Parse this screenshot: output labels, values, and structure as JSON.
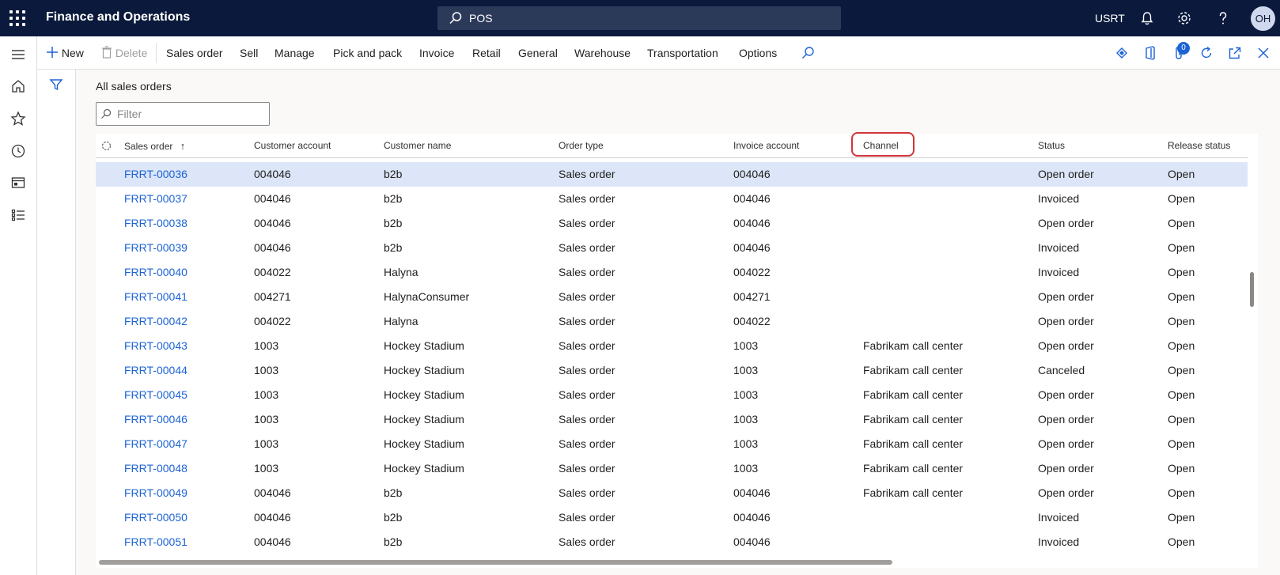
{
  "header": {
    "app_title": "Finance and Operations",
    "search_value": "POS",
    "user_code": "USRT",
    "avatar_initials": "OH"
  },
  "actions": {
    "new_label": "New",
    "delete_label": "Delete",
    "menus": [
      "Sales order",
      "Sell",
      "Manage",
      "Pick and pack",
      "Invoice",
      "Retail",
      "General",
      "Warehouse",
      "Transportation",
      "Options"
    ],
    "attachments_badge": "0"
  },
  "page": {
    "title": "All sales orders",
    "filter_placeholder": "Filter"
  },
  "grid": {
    "columns": [
      "Sales order",
      "Customer account",
      "Customer name",
      "Order type",
      "Invoice account",
      "Channel",
      "Status",
      "Release status"
    ],
    "sort_indicator": "↑",
    "rows": [
      [
        "FRRT-00036",
        "004046",
        "b2b",
        "Sales order",
        "004046",
        "",
        "Open order",
        "Open"
      ],
      [
        "FRRT-00037",
        "004046",
        "b2b",
        "Sales order",
        "004046",
        "",
        "Invoiced",
        "Open"
      ],
      [
        "FRRT-00038",
        "004046",
        "b2b",
        "Sales order",
        "004046",
        "",
        "Open order",
        "Open"
      ],
      [
        "FRRT-00039",
        "004046",
        "b2b",
        "Sales order",
        "004046",
        "",
        "Invoiced",
        "Open"
      ],
      [
        "FRRT-00040",
        "004022",
        "Halyna",
        "Sales order",
        "004022",
        "",
        "Invoiced",
        "Open"
      ],
      [
        "FRRT-00041",
        "004271",
        "HalynaConsumer",
        "Sales order",
        "004271",
        "",
        "Open order",
        "Open"
      ],
      [
        "FRRT-00042",
        "004022",
        "Halyna",
        "Sales order",
        "004022",
        "",
        "Open order",
        "Open"
      ],
      [
        "FRRT-00043",
        "1003",
        "Hockey Stadium",
        "Sales order",
        "1003",
        "Fabrikam call center",
        "Open order",
        "Open"
      ],
      [
        "FRRT-00044",
        "1003",
        "Hockey Stadium",
        "Sales order",
        "1003",
        "Fabrikam call center",
        "Canceled",
        "Open"
      ],
      [
        "FRRT-00045",
        "1003",
        "Hockey Stadium",
        "Sales order",
        "1003",
        "Fabrikam call center",
        "Open order",
        "Open"
      ],
      [
        "FRRT-00046",
        "1003",
        "Hockey Stadium",
        "Sales order",
        "1003",
        "Fabrikam call center",
        "Open order",
        "Open"
      ],
      [
        "FRRT-00047",
        "1003",
        "Hockey Stadium",
        "Sales order",
        "1003",
        "Fabrikam call center",
        "Open order",
        "Open"
      ],
      [
        "FRRT-00048",
        "1003",
        "Hockey Stadium",
        "Sales order",
        "1003",
        "Fabrikam call center",
        "Open order",
        "Open"
      ],
      [
        "FRRT-00049",
        "004046",
        "b2b",
        "Sales order",
        "004046",
        "Fabrikam call center",
        "Open order",
        "Open"
      ],
      [
        "FRRT-00050",
        "004046",
        "b2b",
        "Sales order",
        "004046",
        "",
        "Invoiced",
        "Open"
      ],
      [
        "FRRT-00051",
        "004046",
        "b2b",
        "Sales order",
        "004046",
        "",
        "Invoiced",
        "Open"
      ]
    ],
    "selected_row": 0
  },
  "colors": {
    "header_bg": "#0b1a3c",
    "link": "#1c63d5",
    "selection": "#dce6f8",
    "highlight_circle": "#d13438"
  }
}
